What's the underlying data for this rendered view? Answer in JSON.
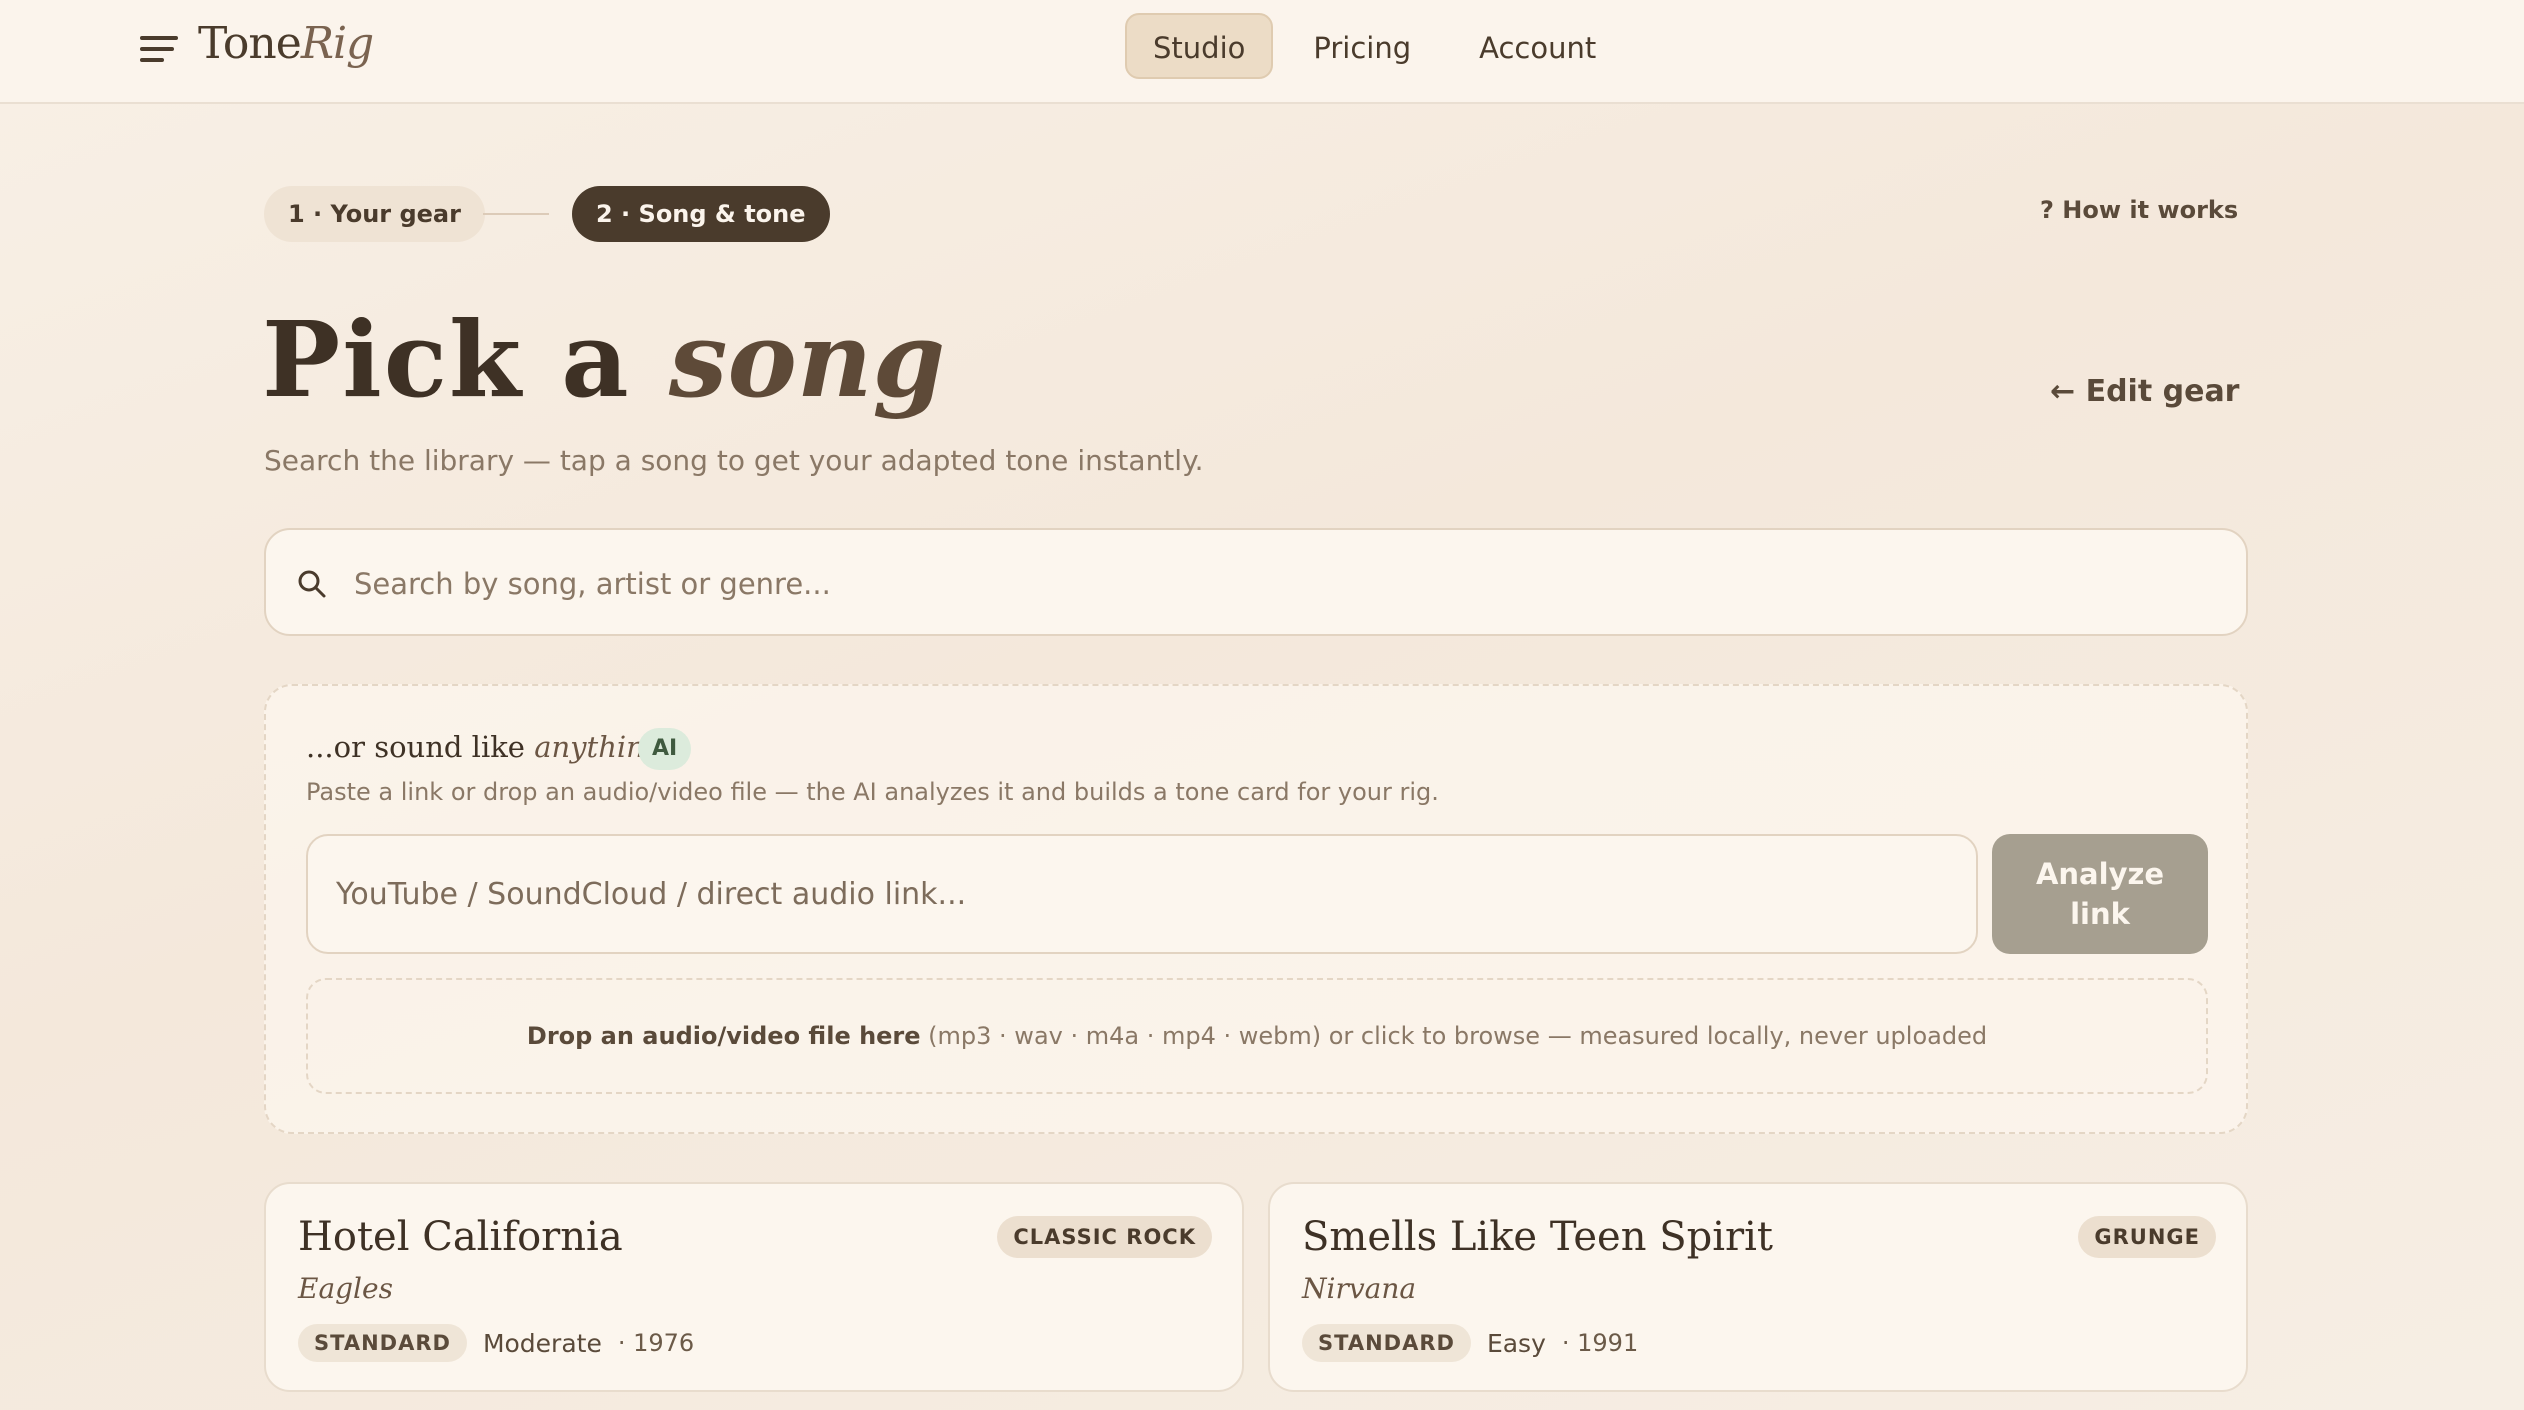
{
  "brand": {
    "name_part1": "Tone",
    "name_part2": "Rig"
  },
  "nav": {
    "tabs": [
      {
        "label": "Studio"
      },
      {
        "label": "Pricing"
      },
      {
        "label": "Account"
      }
    ]
  },
  "steps": {
    "step1": "1 · Your gear",
    "step2": "2 · Song & tone",
    "how_it_works": "? How it works"
  },
  "heading": {
    "part1": "Pick a ",
    "part2": "song"
  },
  "subtitle": "Search the library — tap a song to get your adapted tone instantly.",
  "edit_gear": "← Edit gear",
  "search": {
    "placeholder": "Search by song, artist or genre..."
  },
  "ai": {
    "title_prefix": "...or sound like ",
    "title_italic": "anything",
    "badge": "AI",
    "description": "Paste a link or drop an audio/video file — the AI analyzes it and builds a tone card for your rig.",
    "link_placeholder": "YouTube / SoundCloud / direct audio link...",
    "analyze_label": "Analyze\nlink",
    "drop_strong": "Drop an audio/video file here",
    "drop_rest": " (mp3 · wav · m4a · mp4 · webm) or click to browse — measured locally, never uploaded"
  },
  "songs": [
    {
      "title": "Hotel California",
      "artist": "Eagles",
      "genre": "CLASSIC ROCK",
      "tuning": "STANDARD",
      "difficulty": "Moderate",
      "year": "· 1976"
    },
    {
      "title": "Smells Like Teen Spirit",
      "artist": "Nirvana",
      "genre": "GRUNGE",
      "tuning": "STANDARD",
      "difficulty": "Easy",
      "year": "· 1991"
    }
  ],
  "colors": {
    "accent_dark": "#4a3b2c",
    "background": "#f6ede2",
    "ai_badge": "#dcebdc",
    "analyze_button": "#a69f90"
  }
}
